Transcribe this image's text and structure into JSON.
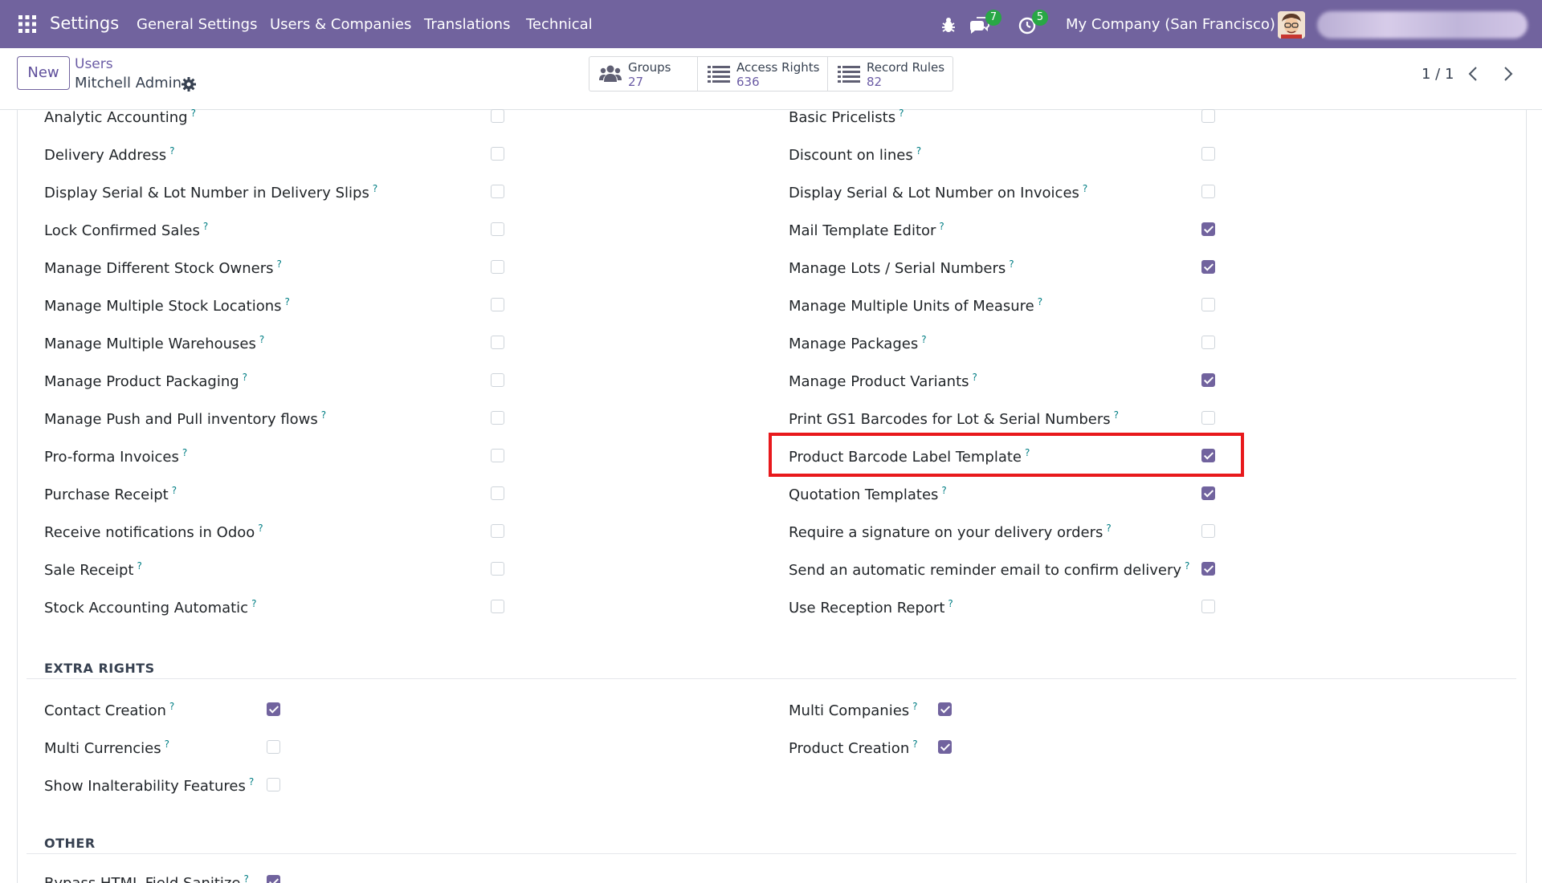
{
  "navbar": {
    "app_name": "Settings",
    "menu": [
      "General Settings",
      "Users & Companies",
      "Translations",
      "Technical"
    ],
    "icons": [
      "apps-grid-icon",
      "bug-icon",
      "chat-icon",
      "activity-clock-icon"
    ],
    "messages_count": "7",
    "activities_count": "5",
    "company": "My Company (San Francisco)"
  },
  "control_panel": {
    "new_label": "New",
    "breadcrumb_parent": "Users",
    "breadcrumb_current": "Mitchell Admin",
    "smart_buttons": [
      {
        "label": "Groups",
        "value": "27",
        "icon": "users-icon"
      },
      {
        "label": "Access Rights",
        "value": "636",
        "icon": "list-icon"
      },
      {
        "label": "Record Rules",
        "value": "82",
        "icon": "list-icon"
      }
    ],
    "pager": "1 / 1"
  },
  "technical_rights": {
    "left": [
      {
        "label": "Analytic Accounting",
        "checked": false
      },
      {
        "label": "Delivery Address",
        "checked": false
      },
      {
        "label": "Display Serial & Lot Number in Delivery Slips",
        "checked": false
      },
      {
        "label": "Lock Confirmed Sales",
        "checked": false
      },
      {
        "label": "Manage Different Stock Owners",
        "checked": false
      },
      {
        "label": "Manage Multiple Stock Locations",
        "checked": false
      },
      {
        "label": "Manage Multiple Warehouses",
        "checked": false
      },
      {
        "label": "Manage Product Packaging",
        "checked": false
      },
      {
        "label": "Manage Push and Pull inventory flows",
        "checked": false
      },
      {
        "label": "Pro-forma Invoices",
        "checked": false
      },
      {
        "label": "Purchase Receipt",
        "checked": false
      },
      {
        "label": "Receive notifications in Odoo",
        "checked": false
      },
      {
        "label": "Sale Receipt",
        "checked": false
      },
      {
        "label": "Stock Accounting Automatic",
        "checked": false
      }
    ],
    "right": [
      {
        "label": "Basic Pricelists",
        "checked": false
      },
      {
        "label": "Discount on lines",
        "checked": false
      },
      {
        "label": "Display Serial & Lot Number on Invoices",
        "checked": false
      },
      {
        "label": "Mail Template Editor",
        "checked": true
      },
      {
        "label": "Manage Lots / Serial Numbers",
        "checked": true
      },
      {
        "label": "Manage Multiple Units of Measure",
        "checked": false
      },
      {
        "label": "Manage Packages",
        "checked": false
      },
      {
        "label": "Manage Product Variants",
        "checked": true
      },
      {
        "label": "Print GS1 Barcodes for Lot & Serial Numbers",
        "checked": false
      },
      {
        "label": "Product Barcode Label Template",
        "checked": true
      },
      {
        "label": "Quotation Templates",
        "checked": true
      },
      {
        "label": "Require a signature on your delivery orders",
        "checked": false
      },
      {
        "label": "Send an automatic reminder email to confirm delivery",
        "checked": true
      },
      {
        "label": "Use Reception Report",
        "checked": false
      }
    ]
  },
  "extra_rights": {
    "title": "EXTRA RIGHTS",
    "left": [
      {
        "label": "Contact Creation",
        "checked": true
      },
      {
        "label": "Multi Currencies",
        "checked": false
      },
      {
        "label": "Show Inalterability Features",
        "checked": false
      }
    ],
    "right": [
      {
        "label": "Multi Companies",
        "checked": true
      },
      {
        "label": "Product Creation",
        "checked": true
      }
    ]
  },
  "other": {
    "title": "OTHER",
    "left": [
      {
        "label": "Bypass HTML Field Sanitize",
        "checked": true
      }
    ]
  },
  "help_marker": "?",
  "colors": {
    "navbar": "#71639e",
    "checkbox_checked": "#71639e",
    "highlight": "#e8191c",
    "tooltip": "#017e84",
    "badge": "#28a745"
  }
}
